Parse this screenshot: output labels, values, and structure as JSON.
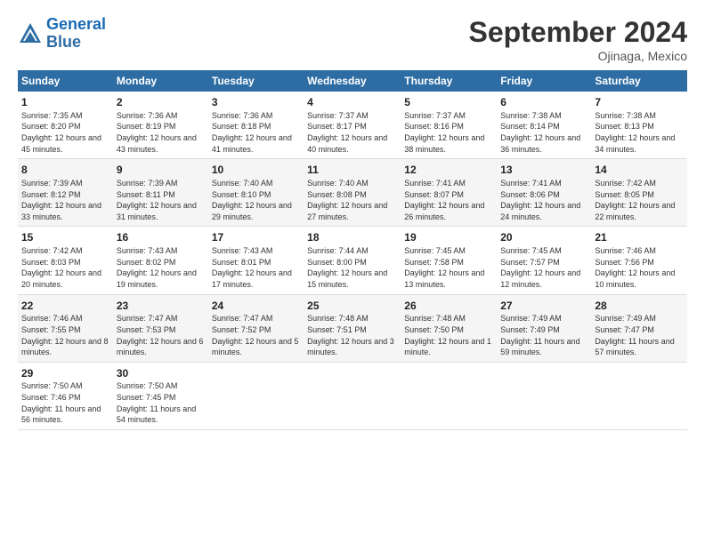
{
  "header": {
    "logo_line1": "General",
    "logo_line2": "Blue",
    "title": "September 2024",
    "subtitle": "Ojinaga, Mexico"
  },
  "days_of_week": [
    "Sunday",
    "Monday",
    "Tuesday",
    "Wednesday",
    "Thursday",
    "Friday",
    "Saturday"
  ],
  "weeks": [
    [
      {
        "day": "1",
        "sunrise": "Sunrise: 7:35 AM",
        "sunset": "Sunset: 8:20 PM",
        "daylight": "Daylight: 12 hours and 45 minutes."
      },
      {
        "day": "2",
        "sunrise": "Sunrise: 7:36 AM",
        "sunset": "Sunset: 8:19 PM",
        "daylight": "Daylight: 12 hours and 43 minutes."
      },
      {
        "day": "3",
        "sunrise": "Sunrise: 7:36 AM",
        "sunset": "Sunset: 8:18 PM",
        "daylight": "Daylight: 12 hours and 41 minutes."
      },
      {
        "day": "4",
        "sunrise": "Sunrise: 7:37 AM",
        "sunset": "Sunset: 8:17 PM",
        "daylight": "Daylight: 12 hours and 40 minutes."
      },
      {
        "day": "5",
        "sunrise": "Sunrise: 7:37 AM",
        "sunset": "Sunset: 8:16 PM",
        "daylight": "Daylight: 12 hours and 38 minutes."
      },
      {
        "day": "6",
        "sunrise": "Sunrise: 7:38 AM",
        "sunset": "Sunset: 8:14 PM",
        "daylight": "Daylight: 12 hours and 36 minutes."
      },
      {
        "day": "7",
        "sunrise": "Sunrise: 7:38 AM",
        "sunset": "Sunset: 8:13 PM",
        "daylight": "Daylight: 12 hours and 34 minutes."
      }
    ],
    [
      {
        "day": "8",
        "sunrise": "Sunrise: 7:39 AM",
        "sunset": "Sunset: 8:12 PM",
        "daylight": "Daylight: 12 hours and 33 minutes."
      },
      {
        "day": "9",
        "sunrise": "Sunrise: 7:39 AM",
        "sunset": "Sunset: 8:11 PM",
        "daylight": "Daylight: 12 hours and 31 minutes."
      },
      {
        "day": "10",
        "sunrise": "Sunrise: 7:40 AM",
        "sunset": "Sunset: 8:10 PM",
        "daylight": "Daylight: 12 hours and 29 minutes."
      },
      {
        "day": "11",
        "sunrise": "Sunrise: 7:40 AM",
        "sunset": "Sunset: 8:08 PM",
        "daylight": "Daylight: 12 hours and 27 minutes."
      },
      {
        "day": "12",
        "sunrise": "Sunrise: 7:41 AM",
        "sunset": "Sunset: 8:07 PM",
        "daylight": "Daylight: 12 hours and 26 minutes."
      },
      {
        "day": "13",
        "sunrise": "Sunrise: 7:41 AM",
        "sunset": "Sunset: 8:06 PM",
        "daylight": "Daylight: 12 hours and 24 minutes."
      },
      {
        "day": "14",
        "sunrise": "Sunrise: 7:42 AM",
        "sunset": "Sunset: 8:05 PM",
        "daylight": "Daylight: 12 hours and 22 minutes."
      }
    ],
    [
      {
        "day": "15",
        "sunrise": "Sunrise: 7:42 AM",
        "sunset": "Sunset: 8:03 PM",
        "daylight": "Daylight: 12 hours and 20 minutes."
      },
      {
        "day": "16",
        "sunrise": "Sunrise: 7:43 AM",
        "sunset": "Sunset: 8:02 PM",
        "daylight": "Daylight: 12 hours and 19 minutes."
      },
      {
        "day": "17",
        "sunrise": "Sunrise: 7:43 AM",
        "sunset": "Sunset: 8:01 PM",
        "daylight": "Daylight: 12 hours and 17 minutes."
      },
      {
        "day": "18",
        "sunrise": "Sunrise: 7:44 AM",
        "sunset": "Sunset: 8:00 PM",
        "daylight": "Daylight: 12 hours and 15 minutes."
      },
      {
        "day": "19",
        "sunrise": "Sunrise: 7:45 AM",
        "sunset": "Sunset: 7:58 PM",
        "daylight": "Daylight: 12 hours and 13 minutes."
      },
      {
        "day": "20",
        "sunrise": "Sunrise: 7:45 AM",
        "sunset": "Sunset: 7:57 PM",
        "daylight": "Daylight: 12 hours and 12 minutes."
      },
      {
        "day": "21",
        "sunrise": "Sunrise: 7:46 AM",
        "sunset": "Sunset: 7:56 PM",
        "daylight": "Daylight: 12 hours and 10 minutes."
      }
    ],
    [
      {
        "day": "22",
        "sunrise": "Sunrise: 7:46 AM",
        "sunset": "Sunset: 7:55 PM",
        "daylight": "Daylight: 12 hours and 8 minutes."
      },
      {
        "day": "23",
        "sunrise": "Sunrise: 7:47 AM",
        "sunset": "Sunset: 7:53 PM",
        "daylight": "Daylight: 12 hours and 6 minutes."
      },
      {
        "day": "24",
        "sunrise": "Sunrise: 7:47 AM",
        "sunset": "Sunset: 7:52 PM",
        "daylight": "Daylight: 12 hours and 5 minutes."
      },
      {
        "day": "25",
        "sunrise": "Sunrise: 7:48 AM",
        "sunset": "Sunset: 7:51 PM",
        "daylight": "Daylight: 12 hours and 3 minutes."
      },
      {
        "day": "26",
        "sunrise": "Sunrise: 7:48 AM",
        "sunset": "Sunset: 7:50 PM",
        "daylight": "Daylight: 12 hours and 1 minute."
      },
      {
        "day": "27",
        "sunrise": "Sunrise: 7:49 AM",
        "sunset": "Sunset: 7:49 PM",
        "daylight": "Daylight: 11 hours and 59 minutes."
      },
      {
        "day": "28",
        "sunrise": "Sunrise: 7:49 AM",
        "sunset": "Sunset: 7:47 PM",
        "daylight": "Daylight: 11 hours and 57 minutes."
      }
    ],
    [
      {
        "day": "29",
        "sunrise": "Sunrise: 7:50 AM",
        "sunset": "Sunset: 7:46 PM",
        "daylight": "Daylight: 11 hours and 56 minutes."
      },
      {
        "day": "30",
        "sunrise": "Sunrise: 7:50 AM",
        "sunset": "Sunset: 7:45 PM",
        "daylight": "Daylight: 11 hours and 54 minutes."
      },
      {
        "day": "",
        "sunrise": "",
        "sunset": "",
        "daylight": ""
      },
      {
        "day": "",
        "sunrise": "",
        "sunset": "",
        "daylight": ""
      },
      {
        "day": "",
        "sunrise": "",
        "sunset": "",
        "daylight": ""
      },
      {
        "day": "",
        "sunrise": "",
        "sunset": "",
        "daylight": ""
      },
      {
        "day": "",
        "sunrise": "",
        "sunset": "",
        "daylight": ""
      }
    ]
  ]
}
